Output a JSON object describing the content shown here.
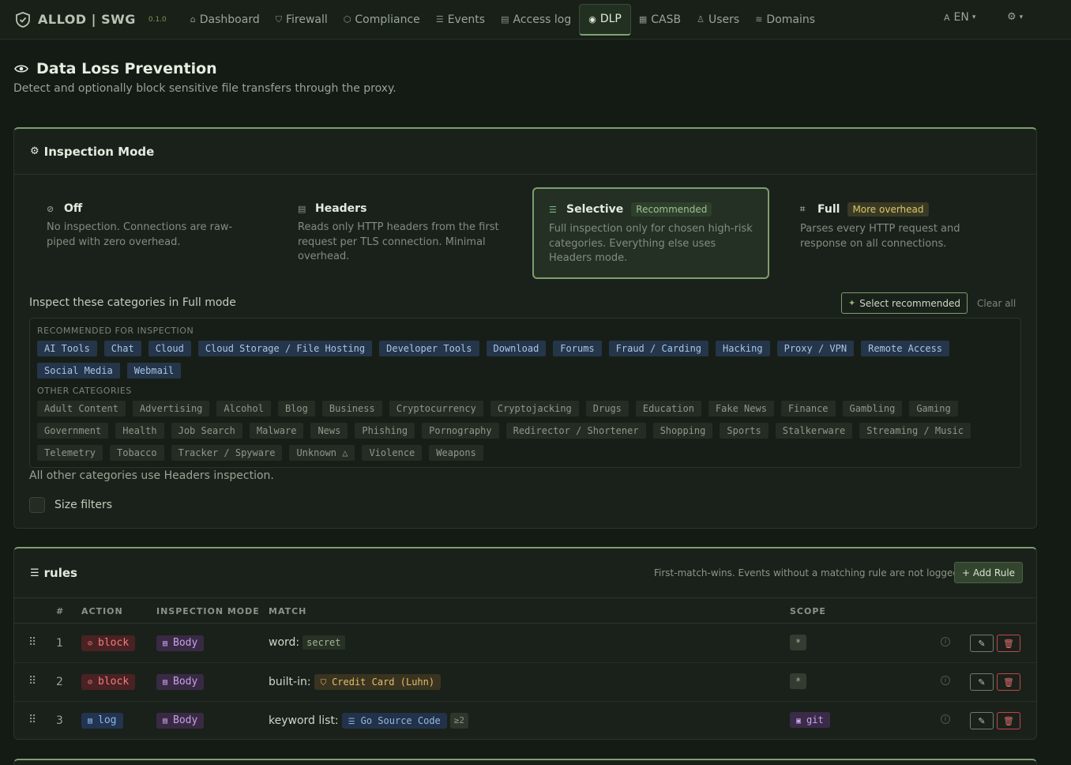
{
  "nav": {
    "brand": "ALLOD | SWG",
    "version": "0.1.0",
    "items": [
      {
        "label": "Dashboard",
        "icon": "home-icon",
        "glyph": "⌂"
      },
      {
        "label": "Firewall",
        "icon": "shield-icon",
        "glyph": "⛉"
      },
      {
        "label": "Compliance",
        "icon": "badge-icon",
        "glyph": "⬡"
      },
      {
        "label": "Events",
        "icon": "list-icon",
        "glyph": "☰"
      },
      {
        "label": "Access log",
        "icon": "file-icon",
        "glyph": "▤"
      },
      {
        "label": "DLP",
        "icon": "eye-icon",
        "glyph": "◉",
        "active": true
      },
      {
        "label": "CASB",
        "icon": "grid-icon",
        "glyph": "▦"
      },
      {
        "label": "Users",
        "icon": "users-icon",
        "glyph": "♙"
      },
      {
        "label": "Domains",
        "icon": "domains-icon",
        "glyph": "≋"
      }
    ],
    "lang": "EN"
  },
  "page": {
    "title": "Data Loss Prevention",
    "subtitle": "Detect and optionally block sensitive file transfers through the proxy."
  },
  "inspection": {
    "title": "Inspection Mode",
    "modes": [
      {
        "name": "Off",
        "icon": "eye-off-icon",
        "glyph": "⊘",
        "badge": "",
        "desc": "No inspection. Connections are raw-piped with zero overhead."
      },
      {
        "name": "Headers",
        "icon": "document-icon",
        "glyph": "▤",
        "badge": "",
        "desc": "Reads only HTTP headers from the first request per TLS connection. Minimal overhead."
      },
      {
        "name": "Selective",
        "icon": "sliders-icon",
        "glyph": "☰",
        "badge": "Recommended",
        "desc": "Full inspection only for chosen high-risk categories. Everything else uses Headers mode.",
        "selected": true
      },
      {
        "name": "Full",
        "icon": "scan-icon",
        "glyph": "⌗",
        "badge": "More overhead",
        "desc": "Parses every HTTP request and response on all connections."
      }
    ],
    "categories_heading": "Inspect these categories in Full mode",
    "select_recommended": "Select recommended",
    "clear_all": "Clear all",
    "recommended_label": "RECOMMENDED FOR INSPECTION",
    "recommended_row1": [
      "AI Tools",
      "Chat",
      "Cloud",
      "Cloud Storage / File Hosting",
      "Developer Tools",
      "Download",
      "Forums",
      "Fraud / Carding",
      "Hacking",
      "Proxy / VPN",
      "Remote Access"
    ],
    "recommended_row2": [
      "Social Media",
      "Webmail"
    ],
    "other_label": "OTHER CATEGORIES",
    "other_row1": [
      "Adult Content",
      "Advertising",
      "Alcohol",
      "Blog",
      "Business",
      "Cryptocurrency",
      "Cryptojacking",
      "Drugs",
      "Education",
      "Fake News",
      "Finance",
      "Gambling",
      "Gaming"
    ],
    "other_row2": [
      "Government",
      "Health",
      "Job Search",
      "Malware",
      "News",
      "Phishing",
      "Pornography",
      "Redirector / Shortener",
      "Shopping",
      "Sports",
      "Stalkerware",
      "Streaming / Music"
    ],
    "other_row3": [
      "Telemetry",
      "Tobacco",
      "Tracker / Spyware",
      "Unknown △",
      "Violence",
      "Weapons"
    ],
    "note": "All other categories use Headers inspection.",
    "size_filters": "Size filters"
  },
  "rules": {
    "title": "rules",
    "note": "First-match-wins. Events without a matching rule are not logged.",
    "add_button": "+ Add Rule",
    "columns": {
      "num": "#",
      "action": "ACTION",
      "mode": "INSPECTION MODE",
      "match": "MATCH",
      "scope": "SCOPE"
    },
    "rows": [
      {
        "num": "1",
        "action": "block",
        "action_glyph": "⊘",
        "mode": "Body",
        "match_label": "word:",
        "match_value": "secret",
        "scope": "*"
      },
      {
        "num": "2",
        "action": "block",
        "action_glyph": "⊘",
        "mode": "Body",
        "match_label": "built-in:",
        "match_value": "Credit Card (Luhn)",
        "scope": "*"
      },
      {
        "num": "3",
        "action": "log",
        "action_glyph": "▤",
        "mode": "Body",
        "match_label": "keyword list:",
        "match_value": "Go Source Code",
        "match_count": "≥2",
        "scope": "git"
      }
    ]
  },
  "colors": {
    "accent": "#7e9f70",
    "block": "#f07c7c",
    "log": "#8fb7e8",
    "body": "#c8a0e6"
  }
}
